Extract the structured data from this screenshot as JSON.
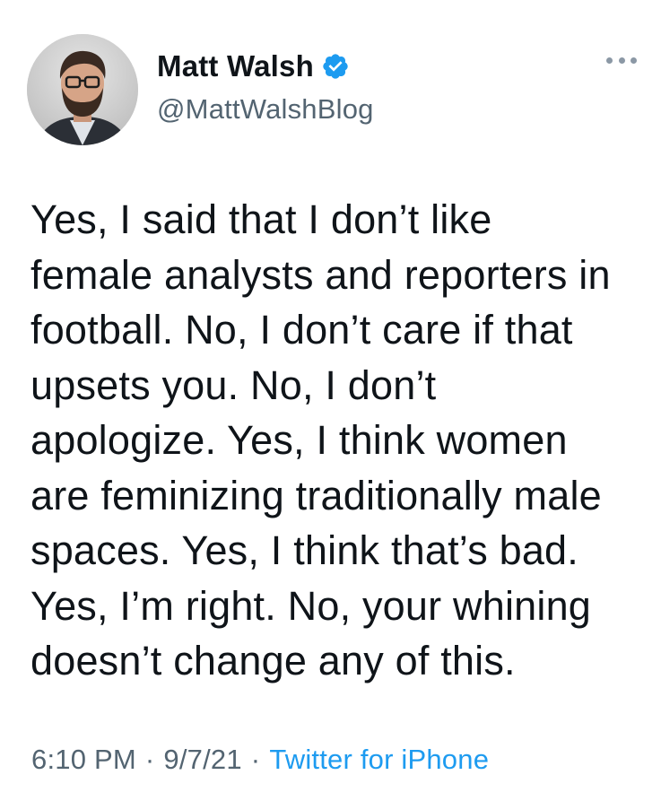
{
  "user": {
    "display_name": "Matt Walsh",
    "handle": "@MattWalshBlog",
    "verified": true,
    "avatar_icon": "profile-photo",
    "verified_icon": "verified-badge-icon"
  },
  "more_icon": "more-options-icon",
  "tweet": {
    "text": "Yes, I said that I don’t like\nfemale analysts and reporters in\nfootball. No, I don’t care if that\nupsets you. No, I don’t\napologize. Yes, I think women\nare feminizing traditionally male\nspaces. Yes, I think that’s bad.\nYes, I’m right. No, your whining\ndoesn’t change any of this."
  },
  "meta": {
    "time": "6:10 PM",
    "separator": "·",
    "date": "9/7/21",
    "source": "Twitter for iPhone"
  },
  "colors": {
    "text": "#0f1419",
    "secondary": "#536471",
    "link": "#1d9bf0",
    "verified": "#1d9bf0"
  }
}
